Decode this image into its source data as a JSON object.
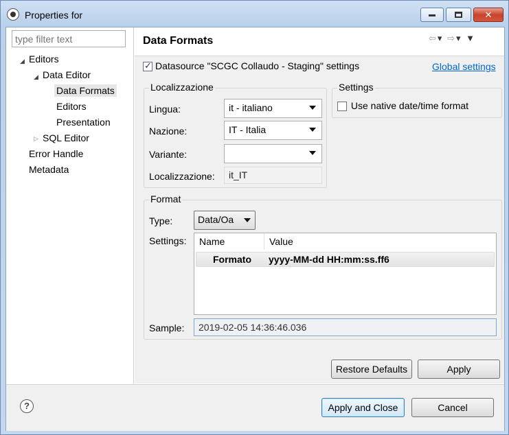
{
  "window": {
    "title": "Properties for"
  },
  "filter": {
    "placeholder": "type filter text"
  },
  "tree": {
    "editors": "Editors",
    "data_editor": "Data Editor",
    "data_formats": "Data Formats",
    "editors_child": "Editors",
    "presentation": "Presentation",
    "sql_editor": "SQL Editor",
    "error_handle": "Error Handle",
    "metadata": "Metadata"
  },
  "header": {
    "title": "Data Formats"
  },
  "datasource": {
    "label": "Datasource \"SCGC Collaudo - Staging\" settings",
    "checked": true,
    "global_link": "Global settings"
  },
  "localizzazione": {
    "title": "Localizzazione",
    "lingua_label": "Lingua:",
    "lingua_value": "it - italiano",
    "nazione_label": "Nazione:",
    "nazione_value": "IT - Italia",
    "variante_label": "Variante:",
    "variante_value": "",
    "loc_label": "Localizzazione:",
    "loc_value": "it_IT"
  },
  "settings": {
    "title": "Settings",
    "native_label": "Use native date/time format",
    "native_checked": false
  },
  "format": {
    "title": "Format",
    "type_label": "Type:",
    "type_value": "Data/Oa",
    "settings_label": "Settings:",
    "columns": [
      "Name",
      "Value"
    ],
    "rows": [
      {
        "name": "Formato",
        "value": "yyyy-MM-dd HH:mm:ss.ff6"
      }
    ],
    "sample_label": "Sample:",
    "sample_value": "2019-02-05 14:36:46.036"
  },
  "buttons": {
    "restore_defaults": "Restore Defaults",
    "apply": "Apply",
    "apply_close": "Apply and Close",
    "cancel": "Cancel"
  }
}
